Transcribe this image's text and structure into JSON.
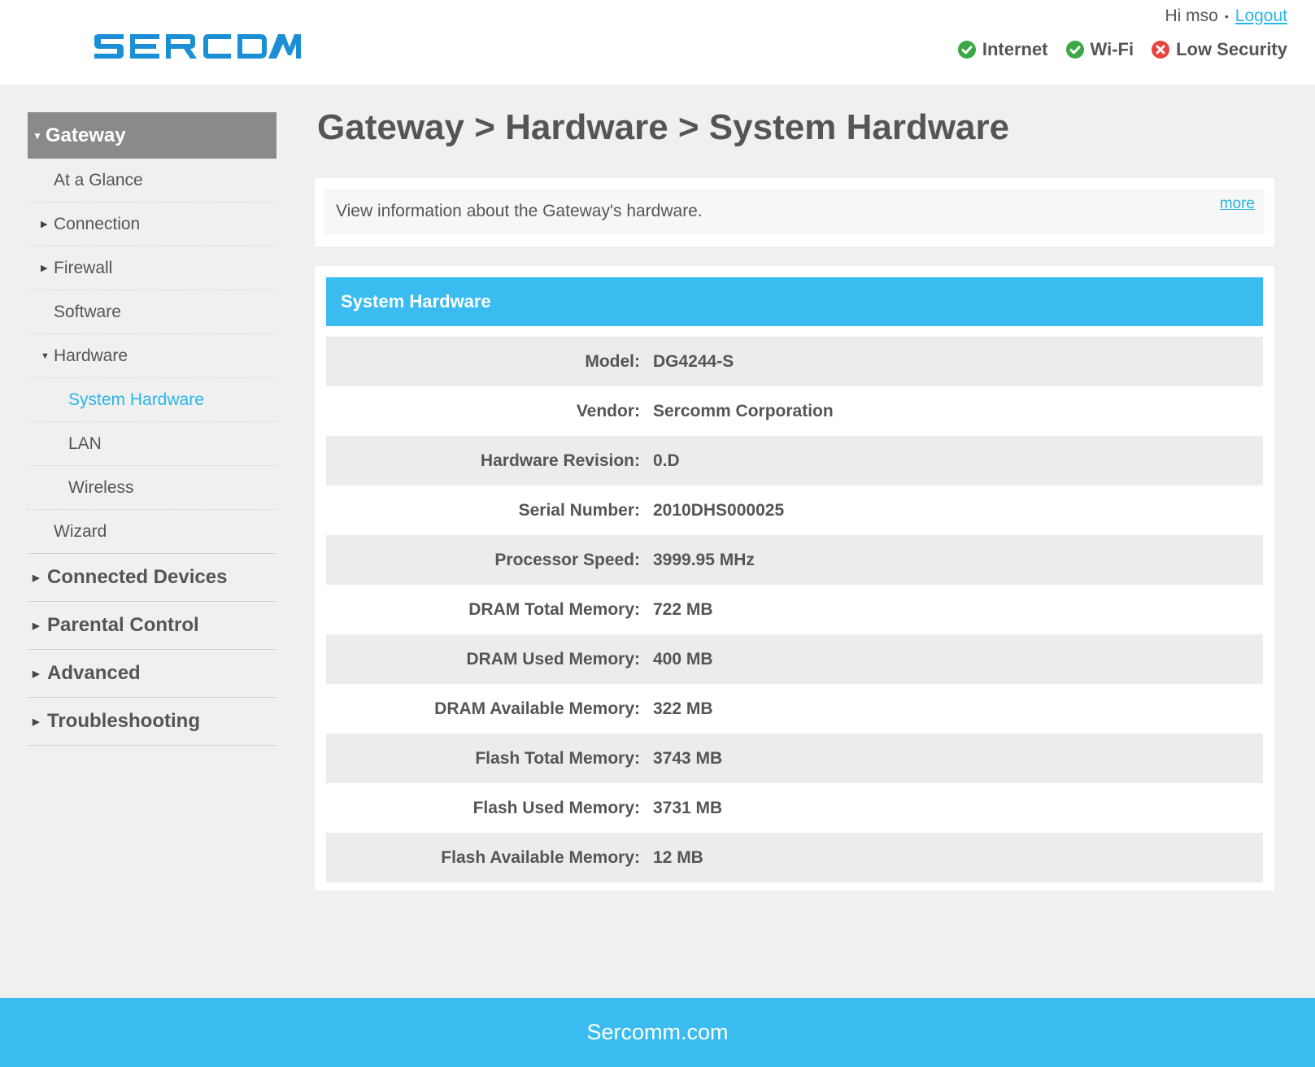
{
  "header": {
    "logo_text": "SERCOMM",
    "greeting": "Hi mso",
    "logout_label": "Logout",
    "status": [
      {
        "label": "Internet",
        "state": "ok",
        "icon": "check-circle-icon"
      },
      {
        "label": "Wi-Fi",
        "state": "ok",
        "icon": "check-circle-icon"
      },
      {
        "label": "Low Security",
        "state": "error",
        "icon": "x-circle-icon"
      }
    ],
    "colors": {
      "ok": "#3aa843",
      "error": "#e8453c",
      "brand": "#1a8fd6"
    }
  },
  "sidebar": {
    "top_label": "Gateway",
    "gateway_items": [
      {
        "label": "At a Glance"
      },
      {
        "label": "Connection"
      },
      {
        "label": "Firewall"
      },
      {
        "label": "Software"
      },
      {
        "label": "Hardware"
      },
      {
        "label": "System Hardware"
      },
      {
        "label": "LAN"
      },
      {
        "label": "Wireless"
      },
      {
        "label": "Wizard"
      }
    ],
    "main_items": [
      {
        "label": "Connected Devices"
      },
      {
        "label": "Parental Control"
      },
      {
        "label": "Advanced"
      },
      {
        "label": "Troubleshooting"
      }
    ]
  },
  "main": {
    "title": "Gateway > Hardware > System Hardware",
    "info_text": "View information about the Gateway's hardware.",
    "more_label": "more",
    "section_title": "System Hardware",
    "rows": [
      {
        "label": "Model:",
        "value": "DG4244-S"
      },
      {
        "label": "Vendor:",
        "value": "Sercomm Corporation"
      },
      {
        "label": "Hardware Revision:",
        "value": "0.D"
      },
      {
        "label": "Serial Number:",
        "value": "2010DHS000025"
      },
      {
        "label": "Processor Speed:",
        "value": "3999.95 MHz"
      },
      {
        "label": "DRAM Total Memory:",
        "value": "722 MB"
      },
      {
        "label": "DRAM Used Memory:",
        "value": "400 MB"
      },
      {
        "label": "DRAM Available Memory:",
        "value": "322 MB"
      },
      {
        "label": "Flash Total Memory:",
        "value": "3743 MB"
      },
      {
        "label": "Flash Used Memory:",
        "value": "3731 MB"
      },
      {
        "label": "Flash Available Memory:",
        "value": "12 MB"
      }
    ]
  },
  "footer": {
    "text": "Sercomm.com",
    "color": "#3bbcf0"
  }
}
